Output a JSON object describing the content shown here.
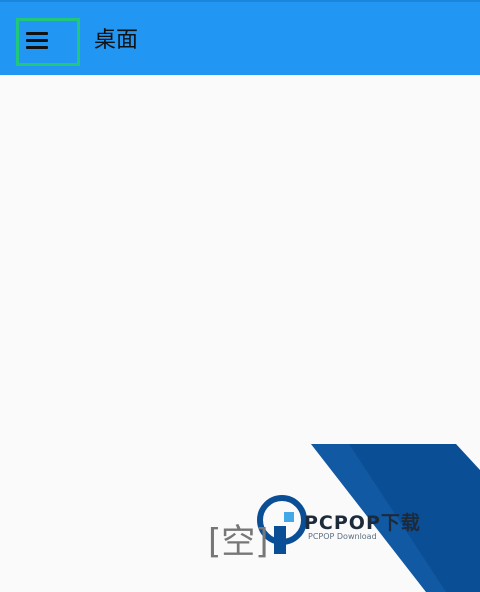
{
  "app_bar": {
    "title": "桌面",
    "menu_icon": "hamburger-menu-icon",
    "background": "#2196f3",
    "focus_outline_color": "#21c77a"
  },
  "watermark": {
    "brand": "PCPOP下载",
    "sub": "PCPOP Download",
    "bracket_text": "[空]",
    "primary_color": "#0a4f96"
  }
}
